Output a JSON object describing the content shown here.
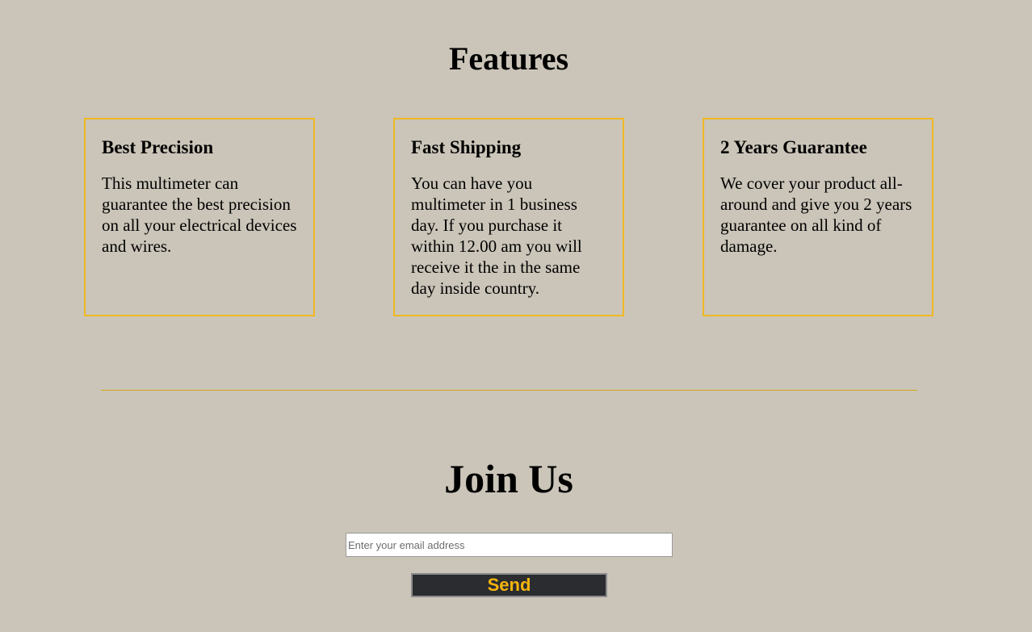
{
  "features": {
    "title": "Features",
    "cards": [
      {
        "heading": "Best Precision",
        "text": "This multimeter can guarantee the best precision on all your electrical devices and wires."
      },
      {
        "heading": "Fast Shipping",
        "text": "You can have you multimeter in 1 business day. If you purchase it within 12.00 am you will receive it the in the same day inside country."
      },
      {
        "heading": "2 Years Guarantee",
        "text": "We cover your product all-around and give you 2 years guarantee on all kind of damage."
      }
    ]
  },
  "join": {
    "title": "Join Us",
    "email_placeholder": "Enter your email address",
    "email_value": "",
    "send_label": "Send"
  },
  "colors": {
    "background": "#cbc5b9",
    "accent": "#f0b820",
    "button_background": "#2b2c30",
    "button_text": "#f5b50d"
  }
}
